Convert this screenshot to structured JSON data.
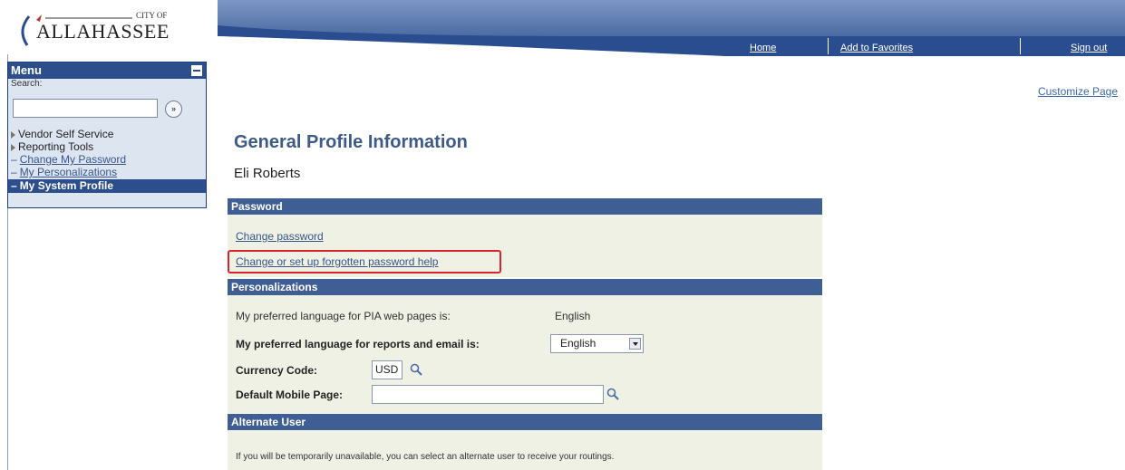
{
  "logo": {
    "city_of": "CITY OF",
    "wordmark": "ALLAHASSEE"
  },
  "topnav": {
    "home": "Home",
    "add_to_favorites": "Add to Favorites",
    "sign_out": "Sign out"
  },
  "menu": {
    "title": "Menu",
    "search_label": "Search:",
    "search_value": "",
    "go_symbol": "»",
    "items": [
      {
        "label": "Vendor Self Service",
        "kind": "folder"
      },
      {
        "label": "Reporting Tools",
        "kind": "folder"
      },
      {
        "label": "Change My Password",
        "kind": "link"
      },
      {
        "label": "My Personalizations",
        "kind": "link"
      },
      {
        "label": "My System Profile",
        "kind": "selected"
      }
    ]
  },
  "customize_page": "Customize Page",
  "page_title": "General Profile Information",
  "user_name": "Eli Roberts",
  "password_section": {
    "title": "Password",
    "change_password": "Change password",
    "forgotten_help": "Change or set up forgotten password help"
  },
  "personalizations": {
    "title": "Personalizations",
    "pia_language_label": "My preferred language for PIA web pages is:",
    "pia_language_value": "English",
    "report_language_label": "My preferred language for reports and email is:",
    "report_language_value": "English",
    "currency_label": "Currency Code:",
    "currency_value": "USD",
    "mobile_label": "Default Mobile Page:",
    "mobile_value": ""
  },
  "alternate_user": {
    "title": "Alternate User",
    "info": "If you will be temporarily unavailable, you can select an alternate user to receive your routings."
  },
  "colors": {
    "accent": "#3f5e93",
    "highlight": "#d9232d",
    "link": "#37558a"
  }
}
